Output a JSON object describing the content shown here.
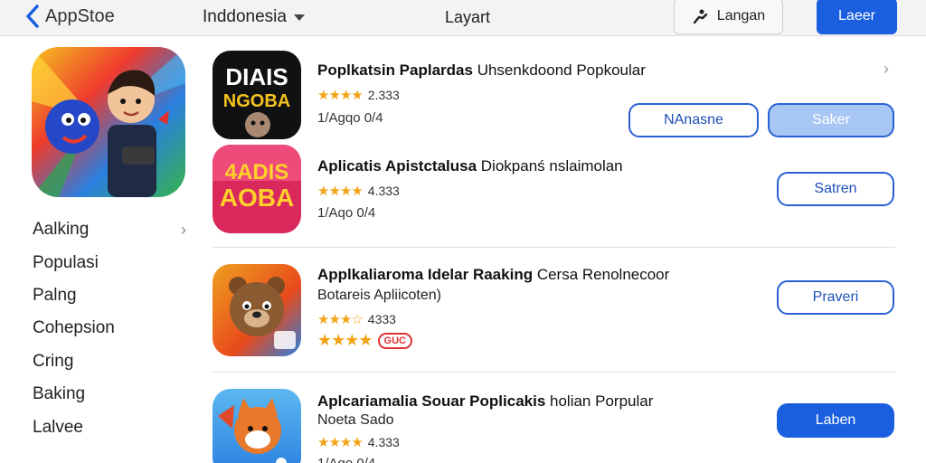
{
  "topbar": {
    "back_label": "AppStoe",
    "region": "Inddonesia",
    "title": "Layart",
    "lang_label": "Langan",
    "primary_label": "Laeer"
  },
  "sidebar": {
    "items": [
      {
        "label": "Aalking"
      },
      {
        "label": "Populasi"
      },
      {
        "label": "Palng"
      },
      {
        "label": "Cohepsion"
      },
      {
        "label": "Cring"
      },
      {
        "label": "Baking"
      },
      {
        "label": "Lalvee"
      }
    ]
  },
  "apps": [
    {
      "title_bold": "Poplkatsin Paplardas",
      "title_rest": "Uhsenkdoond Popkoular",
      "rating": "2.333",
      "meta": "1/Agqo 0/4",
      "icon_text_1": "DIAIS",
      "icon_text_2": "NGOBA",
      "btn_secondary": "NAnasne",
      "btn_primary": "Saker"
    },
    {
      "title_bold": "Aplicatis Apistctalusa",
      "title_rest": "Diokpanś nslaimolan",
      "rating": "4.333",
      "meta": "1/Aqo 0/4",
      "icon_text_1": "4ADIS",
      "icon_text_2": "AOBA",
      "btn_primary": "Satren"
    },
    {
      "title_bold": "Applkaliaroma Idelar Raaking",
      "title_rest": "Cersa Renolnecoor",
      "subtitle": "Botareis Apliicoten)",
      "rating": "4333",
      "badge": "GUC",
      "btn_primary": "Praveri"
    },
    {
      "title_bold": "Aplcariamalia Souar Poplicakis",
      "title_rest": "holian Porpular",
      "subtitle": "Noeta Sado",
      "rating": "4.333",
      "meta": "1/Aqo 0/4",
      "btn_primary": "Laben"
    }
  ],
  "colors": {
    "accent": "#1a5fe0",
    "star": "#f2a316",
    "badge": "#e0312f"
  }
}
